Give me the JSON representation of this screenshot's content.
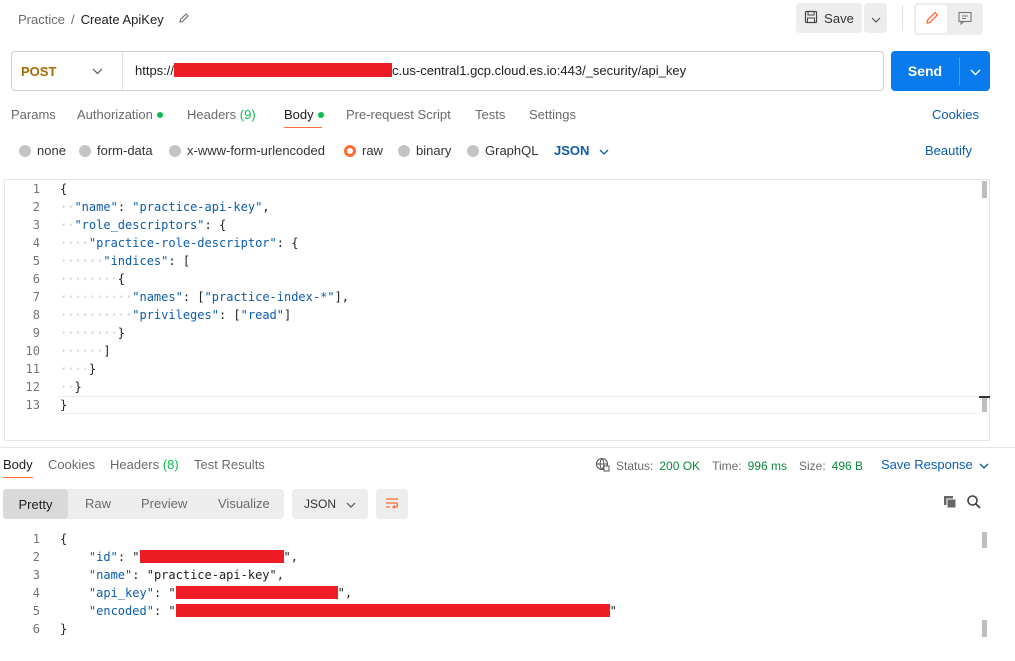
{
  "breadcrumb": {
    "collection": "Practice",
    "separator": "/",
    "title": "Create ApiKey"
  },
  "toolbar": {
    "save_label": "Save"
  },
  "request": {
    "method": "POST",
    "url_prefix": "https://",
    "url_suffix": "c.us-central1.gcp.cloud.es.io:443/_security/api_key",
    "send_label": "Send"
  },
  "tabs": [
    {
      "label": "Params"
    },
    {
      "label": "Authorization"
    },
    {
      "label": "Headers",
      "count": "(9)"
    },
    {
      "label": "Body"
    },
    {
      "label": "Pre-request Script"
    },
    {
      "label": "Tests"
    },
    {
      "label": "Settings"
    }
  ],
  "cookies_label": "Cookies",
  "body_types": [
    "none",
    "form-data",
    "x-www-form-urlencoded",
    "raw",
    "binary",
    "GraphQL"
  ],
  "body_format": "JSON",
  "beautify_label": "Beautify",
  "request_body_lines": [
    "{",
    "  \"name\": \"practice-api-key\",",
    "  \"role_descriptors\": {",
    "    \"practice-role-descriptor\": {",
    "      \"indices\": [",
    "        {",
    "          \"names\": [\"practice-index-*\"],",
    "          \"privileges\": [\"read\"]",
    "        }",
    "      ]",
    "    }",
    "  }",
    "}"
  ],
  "response": {
    "tabs": [
      {
        "label": "Body"
      },
      {
        "label": "Cookies"
      },
      {
        "label": "Headers",
        "count": "(8)"
      },
      {
        "label": "Test Results"
      }
    ],
    "status_label": "Status:",
    "status_value": "200 OK",
    "time_label": "Time:",
    "time_value": "996 ms",
    "size_label": "Size:",
    "size_value": "496 B",
    "save_response_label": "Save Response",
    "view_modes": [
      "Pretty",
      "Raw",
      "Preview",
      "Visualize"
    ],
    "format": "JSON",
    "body_lines": [
      {
        "key": "",
        "text": "{"
      },
      {
        "key": "\"id\"",
        "text": ": \""
      },
      {
        "key": "\"name\"",
        "text": ": \"practice-api-key\","
      },
      {
        "key": "\"api_key\"",
        "text": ": \""
      },
      {
        "key": "\"encoded\"",
        "text": ": \""
      },
      {
        "key": "",
        "text": "}"
      }
    ],
    "line_numbers": [
      "1",
      "2",
      "3",
      "4",
      "5",
      "6"
    ]
  },
  "line_numbers": [
    "1",
    "2",
    "3",
    "4",
    "5",
    "6",
    "7",
    "8",
    "9",
    "10",
    "11",
    "12",
    "13"
  ],
  "colors": {
    "accent": "#ff6c37",
    "send": "#097bed",
    "link": "#0b5cad",
    "success": "#0cbb52",
    "redaction": "#ee1c25"
  }
}
